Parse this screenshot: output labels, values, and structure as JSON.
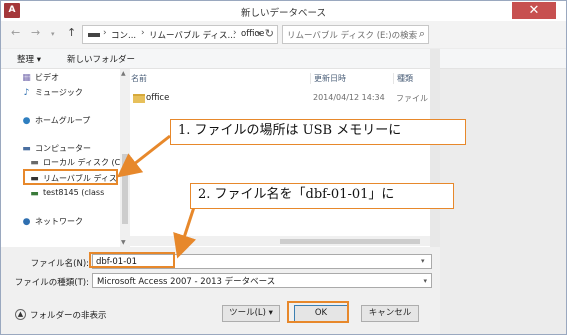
{
  "window": {
    "app_icon": "A",
    "title": "新しいデータベース",
    "close_glyph": "✕"
  },
  "nav": {
    "back_icon": "←",
    "forward_icon": "→",
    "recent_icon": "▾",
    "up_icon": "↑",
    "breadcrumbs": [
      "コン...",
      "リムーバブル ディス...",
      "office"
    ],
    "crumb_sep": "›",
    "address_dropdown": "▾",
    "refresh_icon": "↻",
    "search_placeholder": "リムーバブル ディスク (E:)の検索",
    "search_icon": "⌕"
  },
  "toolbar": {
    "organize_label": "整理 ▾",
    "new_folder_label": "新しいフォルダー"
  },
  "sidebar": {
    "items": [
      {
        "icon": "▦",
        "label": "ビデオ",
        "color": "#7a6fb0"
      },
      {
        "icon": "♪",
        "label": "ミュージック",
        "color": "#2f6fb0"
      },
      {
        "icon": "●",
        "label": "ホームグループ",
        "color": "#2f7fc0"
      },
      {
        "icon": "▬",
        "label": "コンピューター",
        "color": "#4a6fa0"
      },
      {
        "icon": "▬",
        "label": "ローカル ディスク (C",
        "color": "#6a6a6a"
      },
      {
        "icon": "▬",
        "label": "リムーバブル ディス",
        "color": "#333333"
      },
      {
        "icon": "▬",
        "label": "test8145 (class",
        "color": "#3a7a3a"
      },
      {
        "icon": "●",
        "label": "ネットワーク",
        "color": "#2f6fb0"
      }
    ]
  },
  "filelist": {
    "columns": [
      "名前",
      "更新日時",
      "種類"
    ],
    "rows": [
      {
        "name": "office",
        "date": "2014/04/12 14:34",
        "type": "ファイル フォ"
      }
    ]
  },
  "form": {
    "filename_label": "ファイル名(N):",
    "filename_value": "dbf-01-01",
    "filetype_label": "ファイルの種類(T):",
    "filetype_value": "Microsoft Access 2007 - 2013 データベース",
    "dropdown_glyph": "▾"
  },
  "footer": {
    "hide_folders_label": "フォルダーの非表示",
    "hide_icon": "▲",
    "tools_label": "ツール(L)  ▾",
    "ok_label": "OK",
    "cancel_label": "キャンセル"
  },
  "annotations": {
    "callout_1": "1. ファイルの場所は USB メモリーに",
    "callout_2": "2. ファイル名を「dbf-01-01」に",
    "color": "#e7882b"
  }
}
